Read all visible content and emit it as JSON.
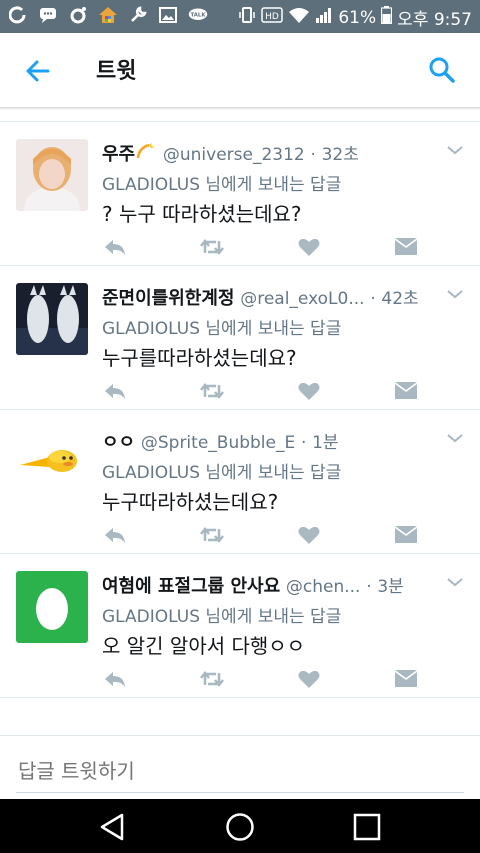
{
  "status_bar": {
    "battery": "61%",
    "time": "오후 9:57",
    "left_icons": [
      "g-app-icon",
      "chat-icon",
      "target-icon",
      "home-icon",
      "wrench-icon",
      "image-icon",
      "talk-icon"
    ],
    "talk_label": "TALK",
    "hd_label": "HD"
  },
  "top_bar": {
    "title": "트윗"
  },
  "tweets": [
    {
      "name": "우주",
      "handle": "@universe_2312",
      "time": "32초",
      "reply_to": "GLADIOLUS 님에게 보내는 답글",
      "text": "? 누구 따라하셨는데요?"
    },
    {
      "name": "준면이를위한계정",
      "handle": "@real_exoL0...",
      "time": "42초",
      "reply_to": "GLADIOLUS 님에게 보내는 답글",
      "text": "누구를따라하셨는데요?"
    },
    {
      "name": "ㅇㅇ",
      "handle": "@Sprite_Bubble_E",
      "time": "1분",
      "reply_to": "GLADIOLUS 님에게 보내는 답글",
      "text": "누구따라하셨는데요?"
    },
    {
      "name": "여혐에 표절그룹 안사요",
      "handle": "@chen...",
      "time": "3분",
      "reply_to": "GLADIOLUS 님에게 보내는 답글",
      "text": "오 알긴 알아서 다행ㅇㅇ"
    }
  ],
  "reply_box": {
    "placeholder": "답글 트윗하기"
  },
  "colors": {
    "status_bar": "#5c6f7a",
    "accent": "#1da1f2",
    "icon_gray": "#aab8c2",
    "text_secondary": "#657786"
  }
}
